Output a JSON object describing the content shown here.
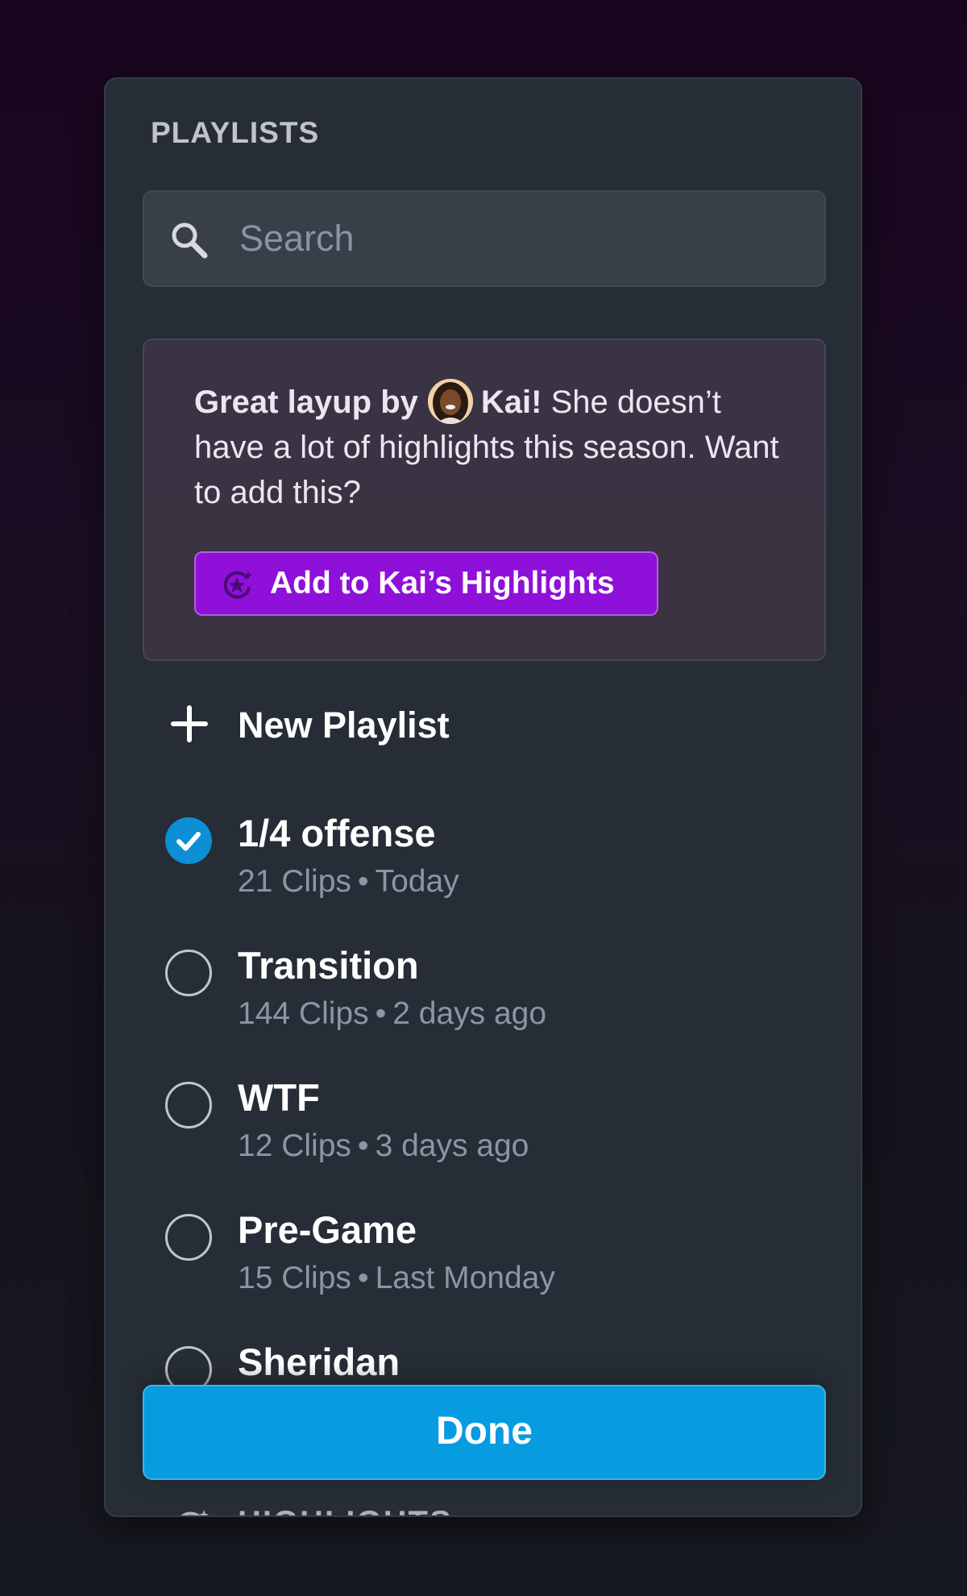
{
  "panel": {
    "title": "PLAYLISTS"
  },
  "search": {
    "placeholder": "Search",
    "value": ""
  },
  "suggestion": {
    "lead": "Great layup by",
    "player_name": "Kai!",
    "message_line1_tail": "She doesn’t",
    "message_rest": "have a lot of highlights this season. Want to add this?",
    "button_label": "Add to Kai’s Highlights"
  },
  "new_playlist": {
    "label": "New Playlist"
  },
  "playlists": [
    {
      "title": "1/4 offense",
      "clips": "21 Clips",
      "when": "Today",
      "selected": true
    },
    {
      "title": "Transition",
      "clips": "144 Clips",
      "when": "2 days ago",
      "selected": false
    },
    {
      "title": "WTF",
      "clips": "12 Clips",
      "when": "3 days ago",
      "selected": false
    },
    {
      "title": "Pre-Game",
      "clips": "15 Clips",
      "when": "Last Monday",
      "selected": false
    },
    {
      "title": "Sheridan",
      "clips": "",
      "when": "",
      "selected": false
    }
  ],
  "meta_separator": "•",
  "done_label": "Done",
  "next_section": {
    "label": "HIGHLIGHTS"
  },
  "colors": {
    "accent_blue": "#079be0",
    "accent_purple": "#8f10d8",
    "panel_bg": "#272d36"
  },
  "icons": {
    "search": "search-icon",
    "add_highlight": "star-sparkle-icon",
    "new": "plus-icon",
    "checked": "check-circle-icon",
    "unchecked": "circle-icon",
    "collapse": "chevron-down-icon"
  }
}
